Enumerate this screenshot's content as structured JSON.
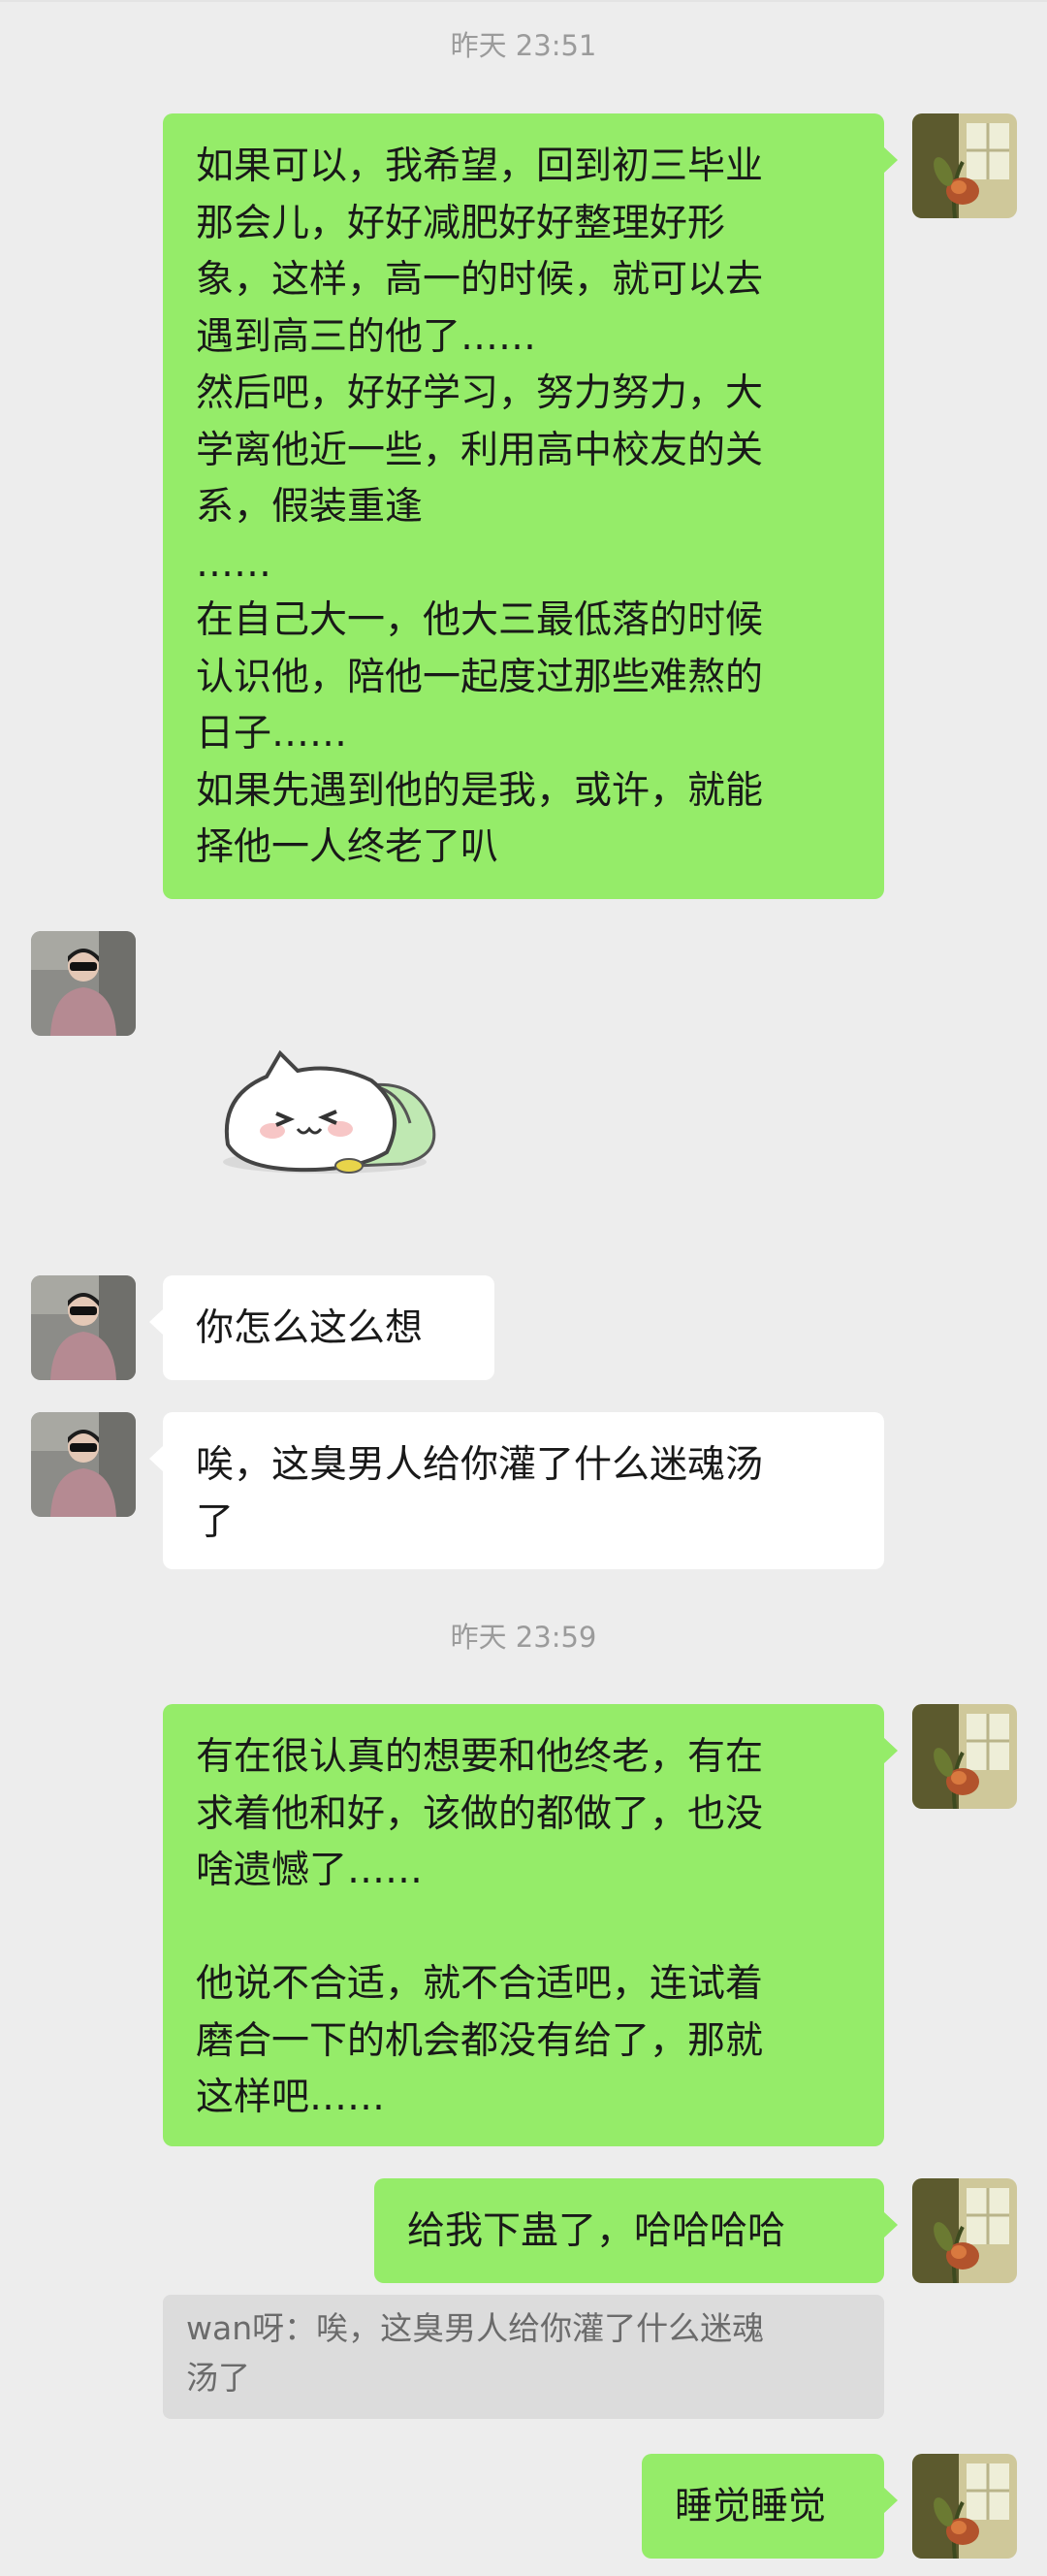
{
  "timestamps": [
    "昨天 23:51",
    "昨天 23:59"
  ],
  "messages": [
    {
      "from": "me",
      "text": "如果可以，我希望，回到初三毕业\n那会儿，好好减肥好好整理好形\n象，这样，高一的时候，就可以去\n遇到高三的他了……\n然后吧，好好学习，努力努力，大\n学离他近一些，利用高中校友的关\n系，假装重逢\n……\n在自己大一，他大三最低落的时候\n认识他，陪他一起度过那些难熬的\n日子……\n如果先遇到他的是我，或许，就能\n择他一人终老了叭"
    },
    {
      "from": "friend",
      "text": "你怎么这么想"
    },
    {
      "from": "friend",
      "text": "唉，这臭男人给你灌了什么迷魂汤\n了"
    },
    {
      "from": "me",
      "text": "有在很认真的想要和他终老，有在\n求着他和好，该做的都做了，也没\n啥遗憾了……\n\n他说不合适，就不合适吧，连试着\n磨合一下的机会都没有给了，那就\n这样吧……"
    },
    {
      "from": "me",
      "text": "给我下蛊了，哈哈哈哈"
    },
    {
      "from": "me",
      "text": "睡觉睡觉"
    }
  ],
  "quote": {
    "text": "wan呀：唉，这臭男人给你灌了什么迷魂\n汤了"
  },
  "sticker": {
    "name": "cat-sticker"
  },
  "colors": {
    "background": "#ededed",
    "sent_bubble": "#95ec69",
    "received_bubble": "#ffffff",
    "quote_background": "#dcdcdc"
  }
}
